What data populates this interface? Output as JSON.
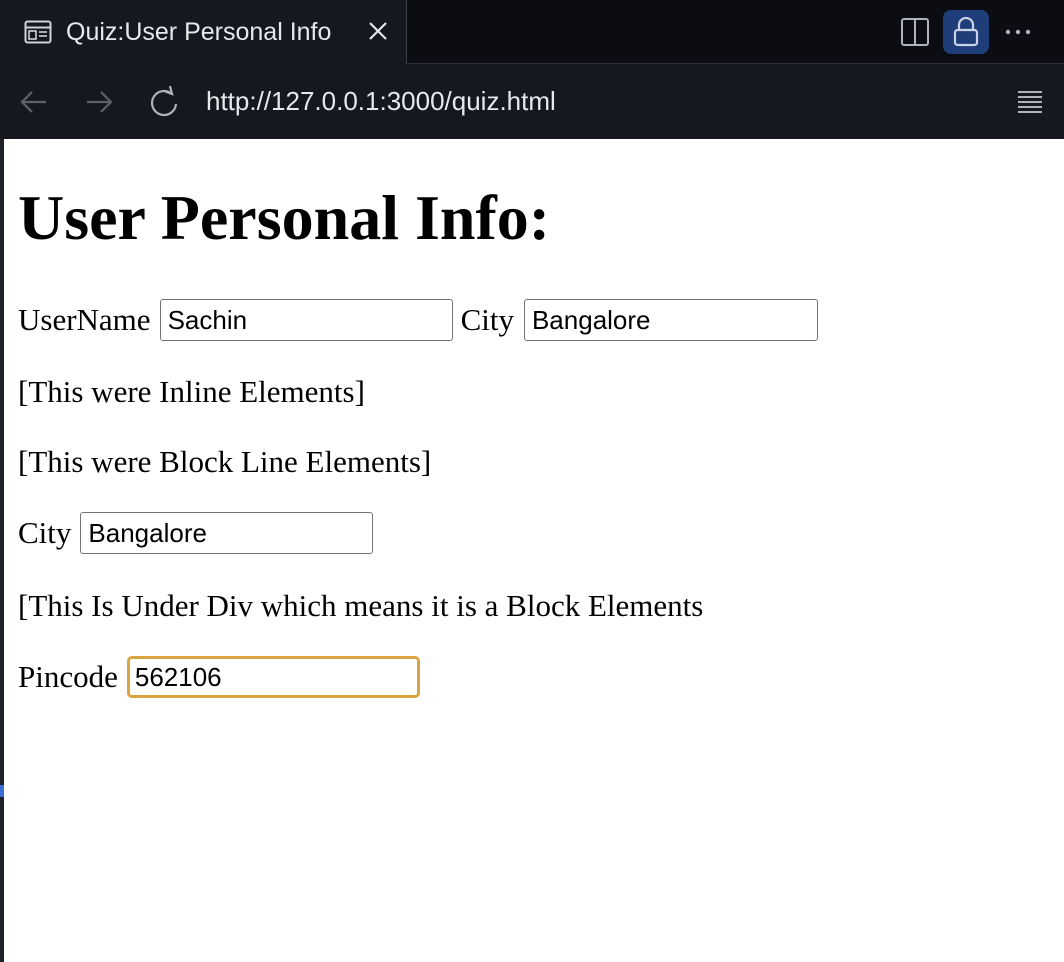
{
  "tab": {
    "title": "Quiz:User Personal Info",
    "icon": "page-layout-icon",
    "close_icon": "close-icon"
  },
  "toolbar": {
    "split_icon": "split-editor-icon",
    "lock_icon": "lock-icon",
    "more_icon": "more-horizontal-icon",
    "lock_accent": "#1f3d78"
  },
  "nav": {
    "back_icon": "arrow-left-icon",
    "forward_icon": "arrow-right-icon",
    "reload_icon": "reload-icon",
    "url": "http://127.0.0.1:3000/quiz.html",
    "menu_icon": "hamburger-menu-icon"
  },
  "page": {
    "heading": "User Personal Info:",
    "row1": {
      "username_label": "UserName",
      "username_value": "Sachin",
      "city_label": "City",
      "city_value": "Bangalore"
    },
    "inline_note": "[This were Inline Elements]",
    "block_note": "[This were Block Line Elements]",
    "row2": {
      "city_label": "City",
      "city_value": "Bangalore"
    },
    "div_note": "[This Is Under Div which means it is a Block Elements",
    "row3": {
      "pincode_label": "Pincode",
      "pincode_value": "562106"
    },
    "focus_color": "#d9a441"
  }
}
